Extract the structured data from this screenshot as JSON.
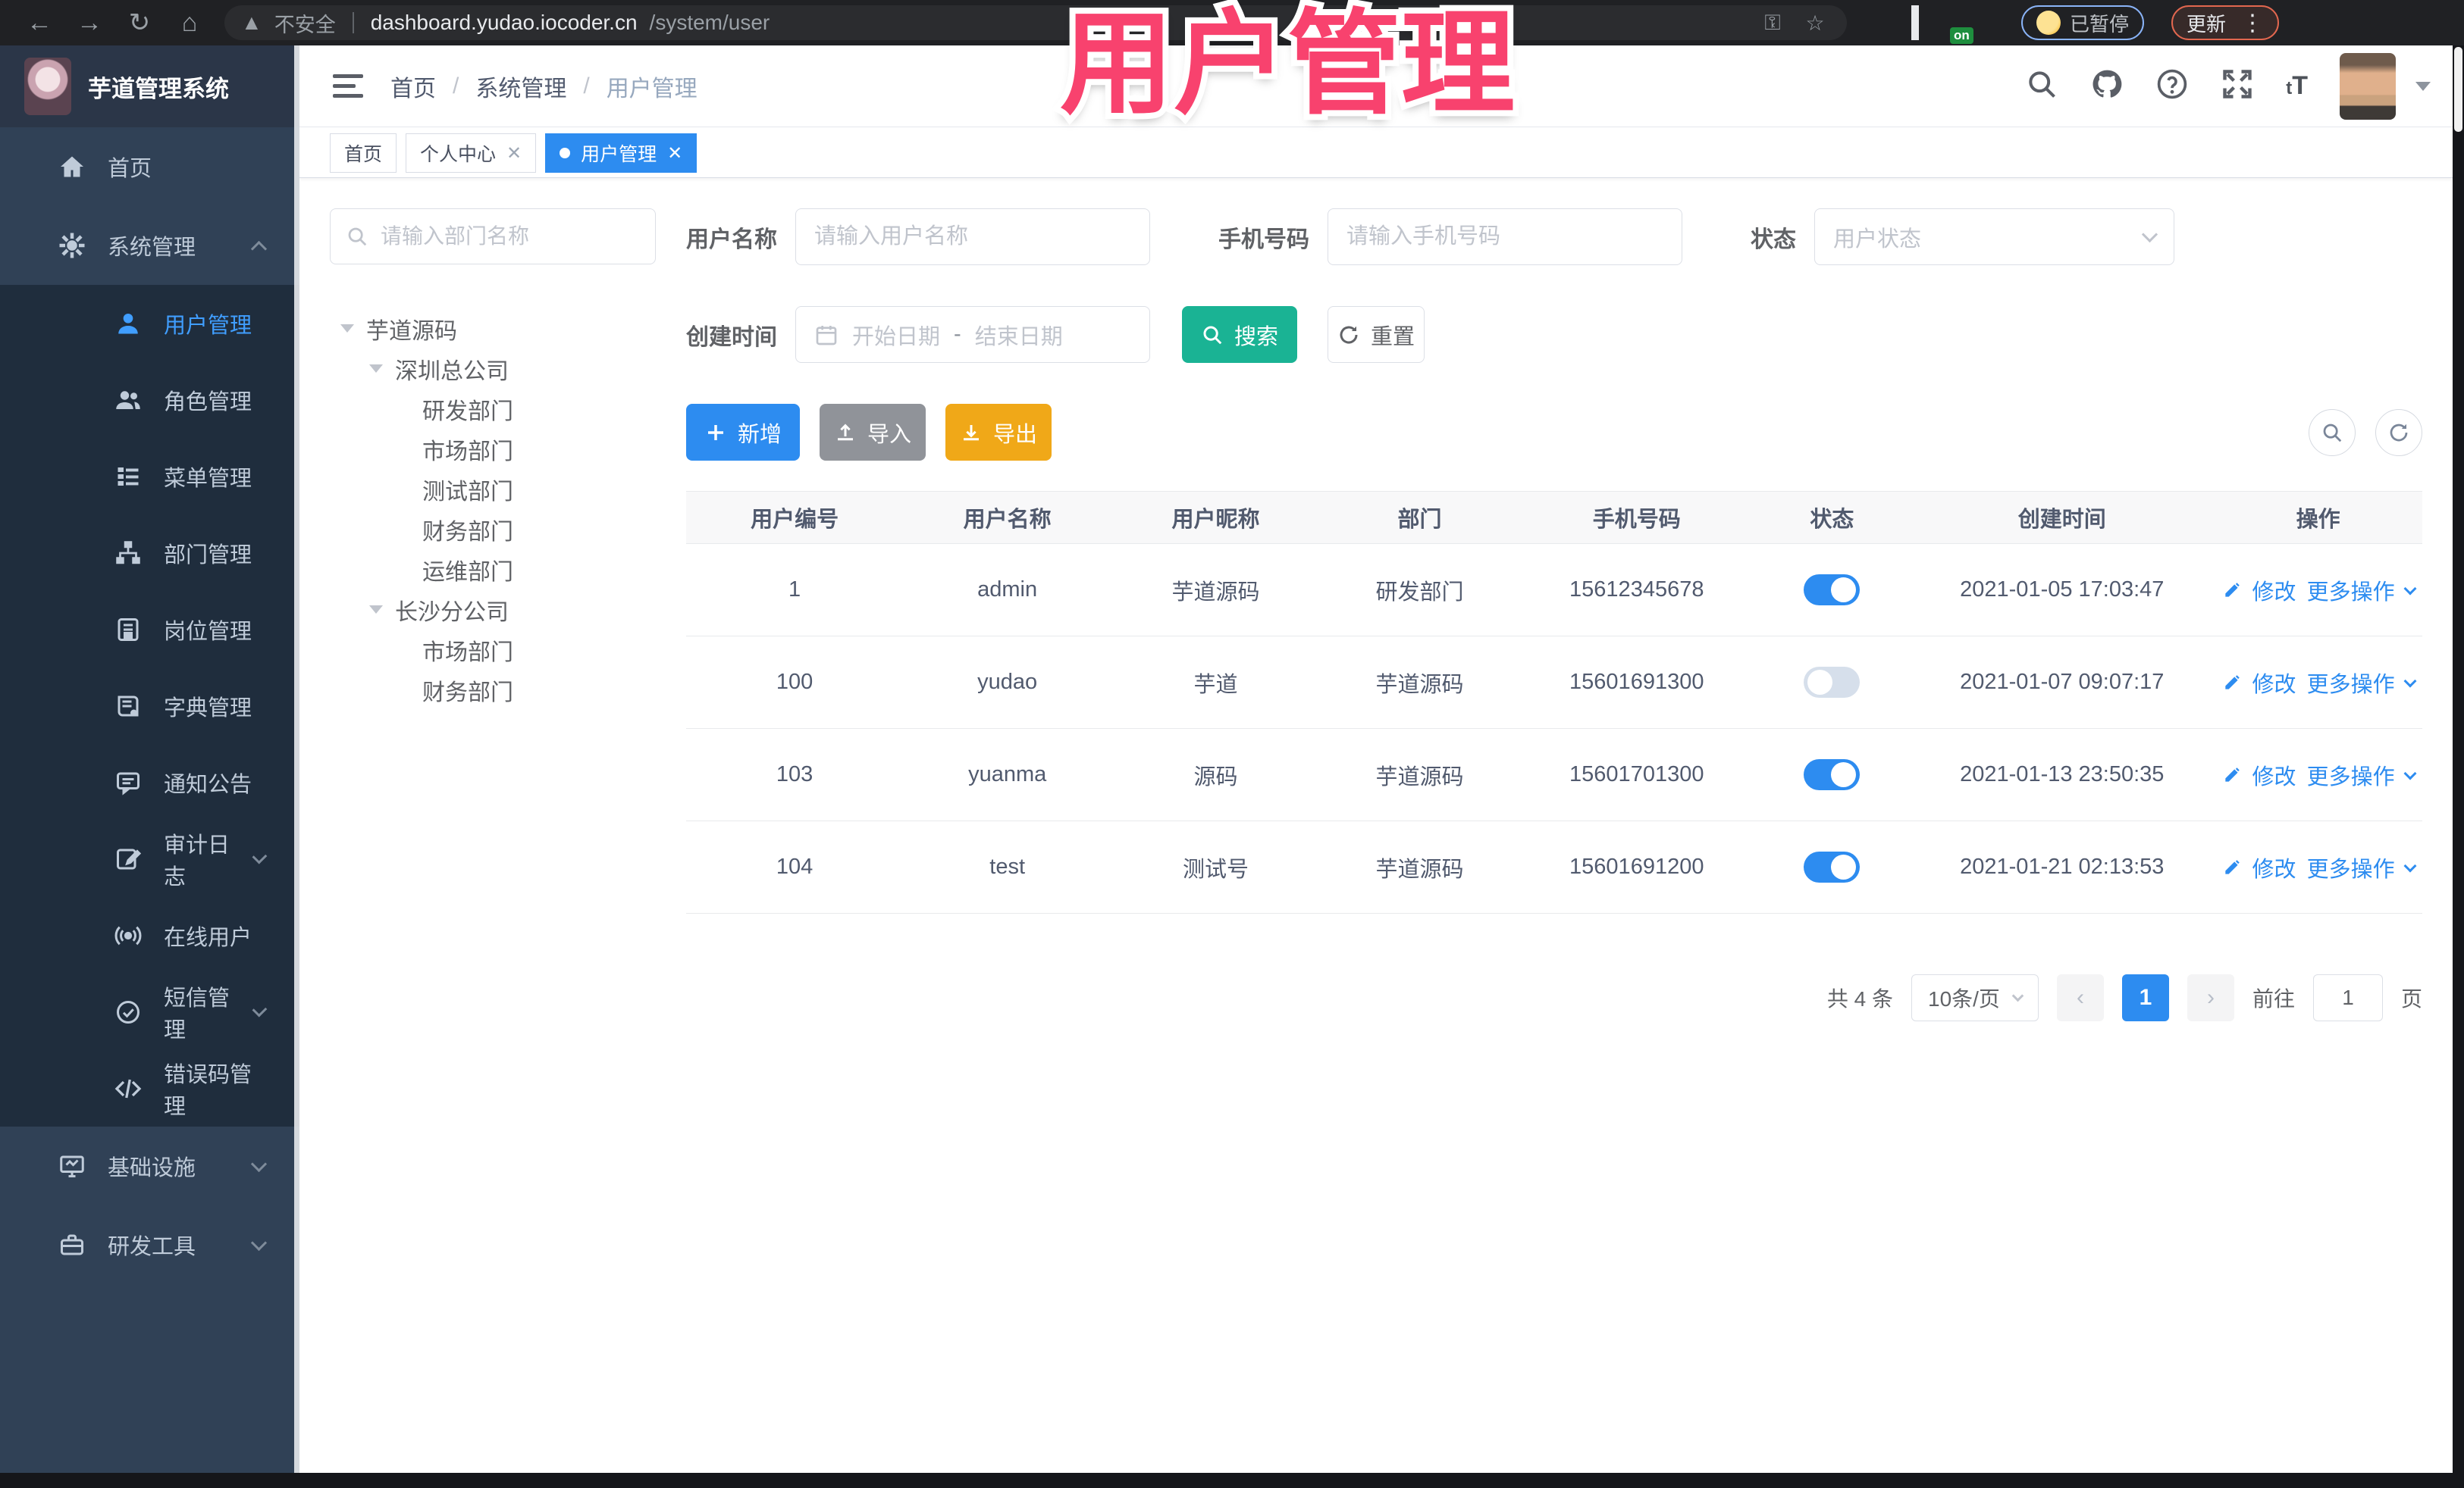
{
  "browser": {
    "security_text": "不安全",
    "url_host": "dashboard.yudao.iocoder.cn",
    "url_path": "/system/user",
    "profile_status": "已暂停",
    "update_label": "更新"
  },
  "overlay_title": "用户管理",
  "colors": {
    "primary": "#2d8cf0",
    "sidebar_bg": "#304156",
    "submenu_bg": "#1f2d3d",
    "search_teal": "#1ab394",
    "export_amber": "#f0a818",
    "overlay_pink": "#f8426e"
  },
  "app": {
    "logo_title": "芋道管理系统",
    "breadcrumb": [
      "首页",
      "系统管理",
      "用户管理"
    ],
    "tabs": [
      {
        "label": "首页"
      },
      {
        "label": "个人中心"
      },
      {
        "label": "用户管理"
      }
    ],
    "sidebar": [
      {
        "label": "首页"
      },
      {
        "label": "系统管理"
      },
      {
        "label": "用户管理"
      },
      {
        "label": "角色管理"
      },
      {
        "label": "菜单管理"
      },
      {
        "label": "部门管理"
      },
      {
        "label": "岗位管理"
      },
      {
        "label": "字典管理"
      },
      {
        "label": "通知公告"
      },
      {
        "label": "审计日志"
      },
      {
        "label": "在线用户"
      },
      {
        "label": "短信管理"
      },
      {
        "label": "错误码管理"
      },
      {
        "label": "基础设施"
      },
      {
        "label": "研发工具"
      }
    ],
    "tree": {
      "search_placeholder": "请输入部门名称",
      "nodes": [
        {
          "label": "芋道源码"
        },
        {
          "label": "深圳总公司"
        },
        {
          "label": "研发部门"
        },
        {
          "label": "市场部门"
        },
        {
          "label": "测试部门"
        },
        {
          "label": "财务部门"
        },
        {
          "label": "运维部门"
        },
        {
          "label": "长沙分公司"
        },
        {
          "label": "市场部门"
        },
        {
          "label": "财务部门"
        }
      ]
    },
    "filters": {
      "username_label": "用户名称",
      "username_placeholder": "请输入用户名称",
      "mobile_label": "手机号码",
      "mobile_placeholder": "请输入手机号码",
      "status_label": "状态",
      "status_placeholder": "用户状态",
      "created_label": "创建时间",
      "date_start_placeholder": "开始日期",
      "date_separator": "-",
      "date_end_placeholder": "结束日期",
      "search_label": "搜索",
      "reset_label": "重置"
    },
    "toolbar": {
      "add_label": "新增",
      "import_label": "导入",
      "export_label": "导出"
    },
    "table": {
      "columns": [
        "用户编号",
        "用户名称",
        "用户昵称",
        "部门",
        "手机号码",
        "状态",
        "创建时间",
        "操作"
      ],
      "row_actions": {
        "edit": "修改",
        "more": "更多操作"
      },
      "rows": [
        {
          "id": "1",
          "username": "admin",
          "nickname": "芋道源码",
          "dept": "研发部门",
          "mobile": "15612345678",
          "status": true,
          "created": "2021-01-05 17:03:47"
        },
        {
          "id": "100",
          "username": "yudao",
          "nickname": "芋道",
          "dept": "芋道源码",
          "mobile": "15601691300",
          "status": false,
          "created": "2021-01-07 09:07:17"
        },
        {
          "id": "103",
          "username": "yuanma",
          "nickname": "源码",
          "dept": "芋道源码",
          "mobile": "15601701300",
          "status": true,
          "created": "2021-01-13 23:50:35"
        },
        {
          "id": "104",
          "username": "test",
          "nickname": "测试号",
          "dept": "芋道源码",
          "mobile": "15601691200",
          "status": true,
          "created": "2021-01-21 02:13:53"
        }
      ]
    },
    "pagination": {
      "total_text": "共 4 条",
      "page_size": "10条/页",
      "current_page": "1",
      "goto_label": "前往",
      "goto_value": "1",
      "page_suffix": "页"
    }
  }
}
